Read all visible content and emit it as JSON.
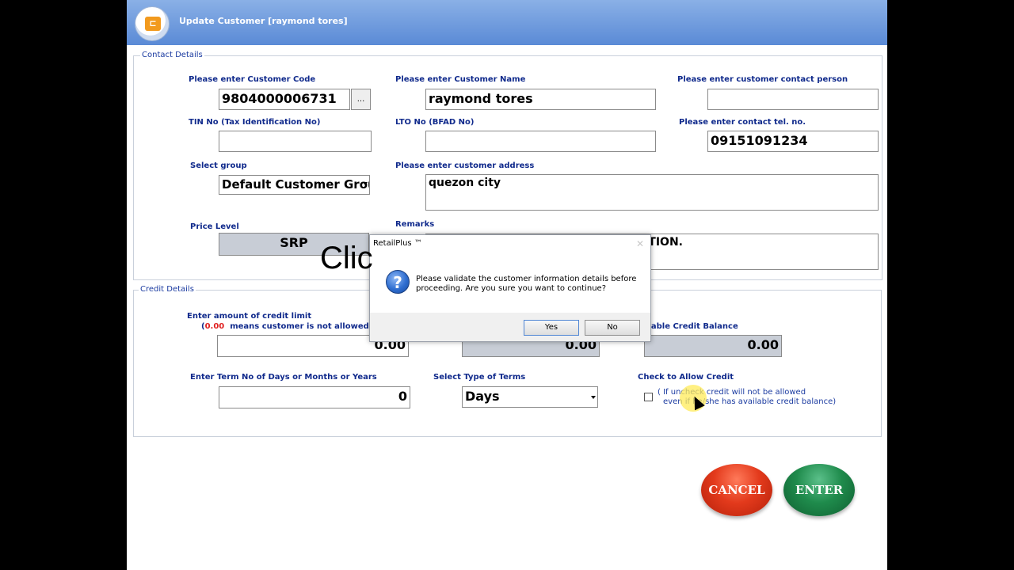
{
  "window": {
    "title": "Update Customer [raymond tores]"
  },
  "contact": {
    "legend": "Contact Details",
    "code_label": "Please enter Customer Code",
    "code_value": "9804000006731",
    "code_btn": "...",
    "name_label": "Please enter Customer Name",
    "name_value": "raymond tores",
    "person_label": "Please enter customer contact person",
    "person_value": "",
    "tin_label": "TIN No (Tax Identification No)",
    "tin_value": "",
    "lto_label": "LTO No (BFAD No)",
    "lto_value": "",
    "tel_label": "Please enter contact tel. no.",
    "tel_value": "09151091234",
    "group_label": "Select group",
    "group_value": "Default Customer Grou",
    "address_label": "Please enter customer address",
    "address_value": "quezon city",
    "price_label": "Price Level",
    "price_value": "SRP",
    "remarks_label": "Remarks",
    "remarks_value": "TION."
  },
  "credit": {
    "legend": "Credit Details",
    "limit_label": "Enter amount of credit limit",
    "limit_hint_value": "0.00",
    "limit_hint_text": "means customer is not allowed fo",
    "limit_value": "0.00",
    "middle_value": "0.00",
    "available_label": "ilable Credit Balance",
    "available_value": "0.00",
    "term_label": "Enter Term No of Days or Months or Years",
    "term_value": "0",
    "type_label": "Select Type of Terms",
    "type_value": "Days",
    "allow_label": "Check to Allow Credit",
    "allow_note_1": "( If uncheck credit will not be allowed",
    "allow_note_2": "even if he/she has available credit balance)"
  },
  "buttons": {
    "cancel": "CANCEL",
    "enter": "ENTER"
  },
  "dialog": {
    "title": "RetailPlus ™",
    "message": "Please validate the customer information details before proceeding. Are you sure you want to continue?",
    "yes": "Yes",
    "no": "No"
  },
  "overlay": {
    "caption": "Clic"
  }
}
